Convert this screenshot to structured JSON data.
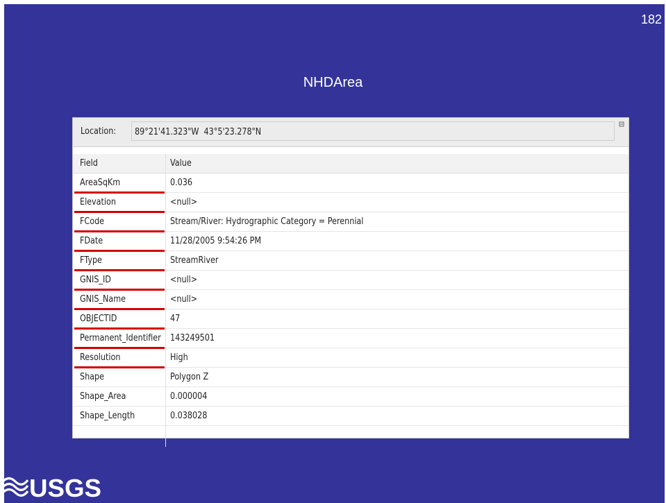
{
  "slide": {
    "number": "182",
    "title": "NHDArea"
  },
  "location": {
    "label": "Location:",
    "value": "89°21'41.323\"W  43°5'23.278\"N"
  },
  "table": {
    "headers": {
      "field": "Field",
      "value": "Value"
    },
    "rows": [
      {
        "field": "AreaSqKm",
        "value": "0.036",
        "highlighted": true
      },
      {
        "field": "Elevation",
        "value": "<null>",
        "highlighted": true
      },
      {
        "field": "FCode",
        "value": "Stream/River: Hydrographic Category = Perennial",
        "highlighted": true
      },
      {
        "field": "FDate",
        "value": "11/28/2005 9:54:26 PM",
        "highlighted": true
      },
      {
        "field": "FType",
        "value": "StreamRiver",
        "highlighted": true
      },
      {
        "field": "GNIS_ID",
        "value": "<null>",
        "highlighted": true
      },
      {
        "field": "GNIS_Name",
        "value": "<null>",
        "highlighted": true
      },
      {
        "field": "OBJECTID",
        "value": "47",
        "highlighted": true
      },
      {
        "field": "Permanent_Identifier",
        "value": "143249501",
        "highlighted": true
      },
      {
        "field": "Resolution",
        "value": "High",
        "highlighted": true
      },
      {
        "field": "Shape",
        "value": "Polygon Z",
        "highlighted": false
      },
      {
        "field": "Shape_Area",
        "value": "0.000004",
        "highlighted": false
      },
      {
        "field": "Shape_Length",
        "value": "0.038028",
        "highlighted": false
      }
    ]
  },
  "logo": {
    "text": "USGS",
    "icon": "usgs-wave-icon"
  },
  "colors": {
    "background": "#333399",
    "highlight_underline": "#d40000"
  }
}
